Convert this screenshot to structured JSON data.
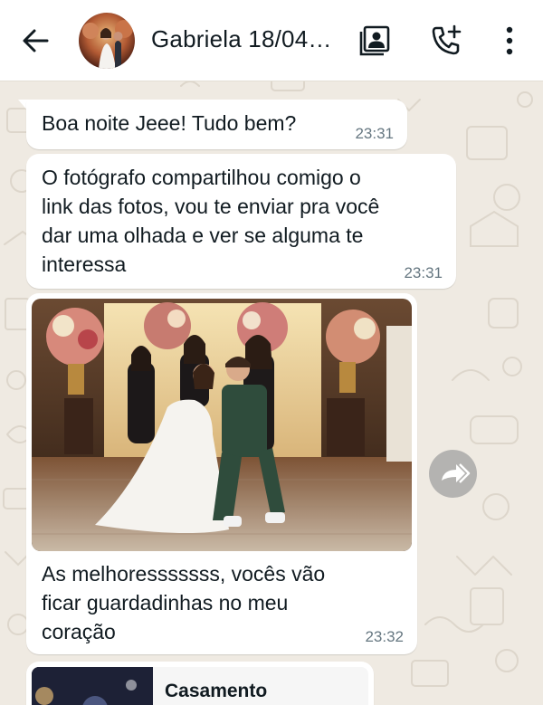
{
  "header": {
    "contact_name": "Gabriela 18/04…",
    "icons": [
      "back-arrow-icon",
      "contact-card-icon",
      "add-call-icon",
      "more-vert-icon"
    ]
  },
  "messages": [
    {
      "text": "Boa noite Jeee! Tudo bem?",
      "time": "23:31"
    },
    {
      "text": "O fotógrafo compartilhou comigo o\nlink das fotos, vou te enviar pra você\ndar uma olhada e ver se alguma te\ninteressa",
      "time": "23:31"
    },
    {
      "text": "As melhoresssssss, vocês vão\nficar guardadinhas no meu\ncoração",
      "time": "23:32",
      "has_photo": true
    }
  ],
  "link_preview": {
    "title": "Casamento"
  },
  "colors": {
    "chat_background": "#efeae2",
    "bubble": "#ffffff",
    "time_text": "#667781",
    "primary_text": "#111b21"
  }
}
